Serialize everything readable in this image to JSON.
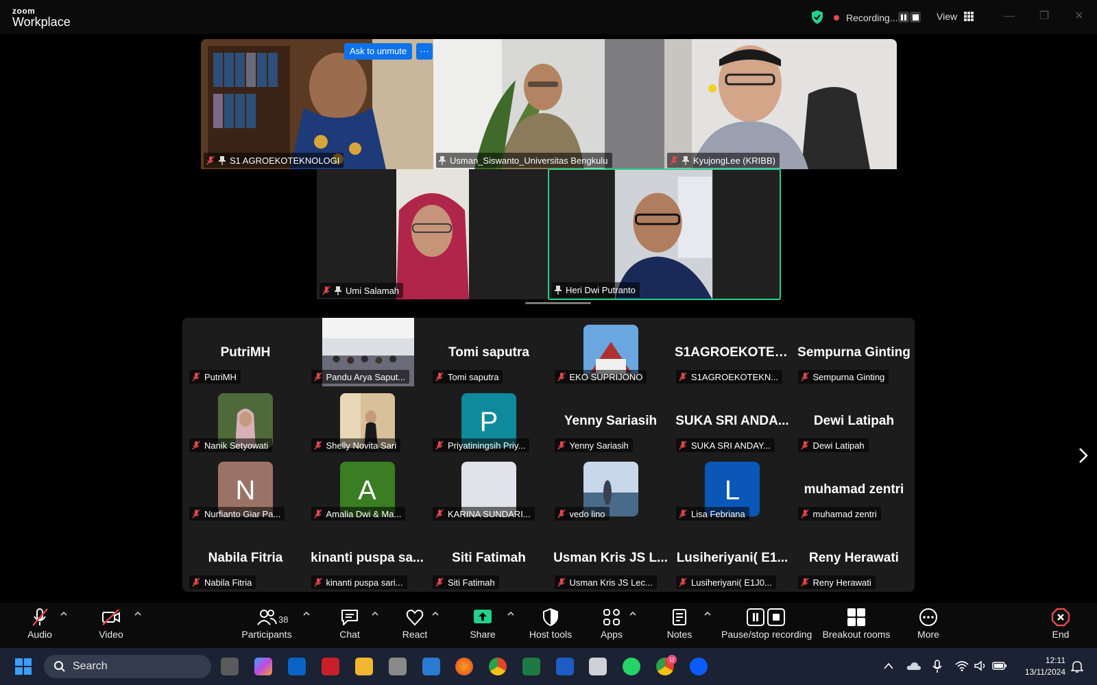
{
  "app": {
    "brand_top": "zoom",
    "brand_bottom": "Workplace"
  },
  "titlebar": {
    "recording_label": "Recording...",
    "view_label": "View"
  },
  "speaker_tiles": [
    {
      "name": "S1 AGROEKOTEKNOLOGI",
      "muted": true,
      "pinned": true
    },
    {
      "name": "Usman_Siswanto_Universitas Bengkulu",
      "muted": false,
      "pinned": true
    },
    {
      "name": "KyujongLee (KRIBB)",
      "muted": true,
      "pinned": true
    },
    {
      "name": "Umi Salamah",
      "muted": true,
      "pinned": true
    },
    {
      "name": "Heri Dwi Putranto",
      "muted": false,
      "pinned": true,
      "active_speaker": true
    }
  ],
  "ask_to_unmute_label": "Ask to unmute",
  "more_options_label": "···",
  "gallery": [
    {
      "big": "PutriMH",
      "label": "PutriMH",
      "avatar": null
    },
    {
      "big": "",
      "label": "Pandu Arya Saput...",
      "avatar": "photo-hall"
    },
    {
      "big": "Tomi saputra",
      "label": "Tomi saputra",
      "avatar": null
    },
    {
      "big": "",
      "label": "EKO SUPRIJONO",
      "avatar": "photo-building"
    },
    {
      "big": "S1AGROEKOTEK...",
      "label": "S1AGROEKOTEKN...",
      "avatar": null
    },
    {
      "big": "Sempurna Ginting",
      "label": "Sempurna Ginting",
      "avatar": null
    },
    {
      "big": "",
      "label": "Nanik Setyowati",
      "avatar": "photo-woman"
    },
    {
      "big": "",
      "label": "Shelly Novita Sari",
      "avatar": "photo-girl"
    },
    {
      "big": "",
      "label": "Priyatiningsih Priy...",
      "avatar": "letter",
      "letter": "P",
      "color": "#0f8a9c"
    },
    {
      "big": "Yenny Sariasih",
      "label": "Yenny Sariasih",
      "avatar": null
    },
    {
      "big": "SUKA SRI ANDA...",
      "label": "SUKA SRI ANDAY...",
      "avatar": null
    },
    {
      "big": "Dewi Latipah",
      "label": "Dewi Latipah",
      "avatar": null
    },
    {
      "big": "",
      "label": "Nurfianto Giar Pa...",
      "avatar": "letter",
      "letter": "N",
      "color": "#9b7366"
    },
    {
      "big": "",
      "label": "Amalia Dwi & Ma...",
      "avatar": "letter",
      "letter": "A",
      "color": "#3a7d22"
    },
    {
      "big": "",
      "label": "KARINA SUNDARI...",
      "avatar": "photo-light"
    },
    {
      "big": "",
      "label": "vedo lino",
      "avatar": "photo-sea"
    },
    {
      "big": "",
      "label": "Lisa Febriana",
      "avatar": "letter",
      "letter": "L",
      "color": "#0a57b8"
    },
    {
      "big": "muhamad zentri",
      "label": "muhamad zentri",
      "avatar": null
    },
    {
      "big": "Nabila Fitria",
      "label": "Nabila Fitria",
      "avatar": null
    },
    {
      "big": "kinanti puspa sa...",
      "label": "kinanti puspa sari...",
      "avatar": null
    },
    {
      "big": "Siti Fatimah",
      "label": "Siti Fatimah",
      "avatar": null
    },
    {
      "big": "Usman Kris JS L...",
      "label": "Usman Kris JS Lec...",
      "avatar": null
    },
    {
      "big": "Lusiheriyani( E1...",
      "label": "Lusiheriyani( E1J0...",
      "avatar": null
    },
    {
      "big": "Reny Herawati",
      "label": "Reny Herawati",
      "avatar": null
    }
  ],
  "toolbar": {
    "audio": "Audio",
    "video": "Video",
    "participants": "Participants",
    "participants_count": "38",
    "chat": "Chat",
    "react": "React",
    "share": "Share",
    "host_tools": "Host tools",
    "apps": "Apps",
    "notes": "Notes",
    "pause_stop_recording": "Pause/stop recording",
    "breakout_rooms": "Breakout rooms",
    "more": "More",
    "end": "End"
  },
  "taskbar": {
    "search_placeholder": "Search",
    "time": "12:11",
    "date": "13/11/2024",
    "chrome_badge": "U"
  },
  "colors": {
    "accent": "#0e72ed",
    "active_speaker": "#23d18b",
    "muted": "#e5484d",
    "end": "#e5484d",
    "share": "#23d18b"
  }
}
